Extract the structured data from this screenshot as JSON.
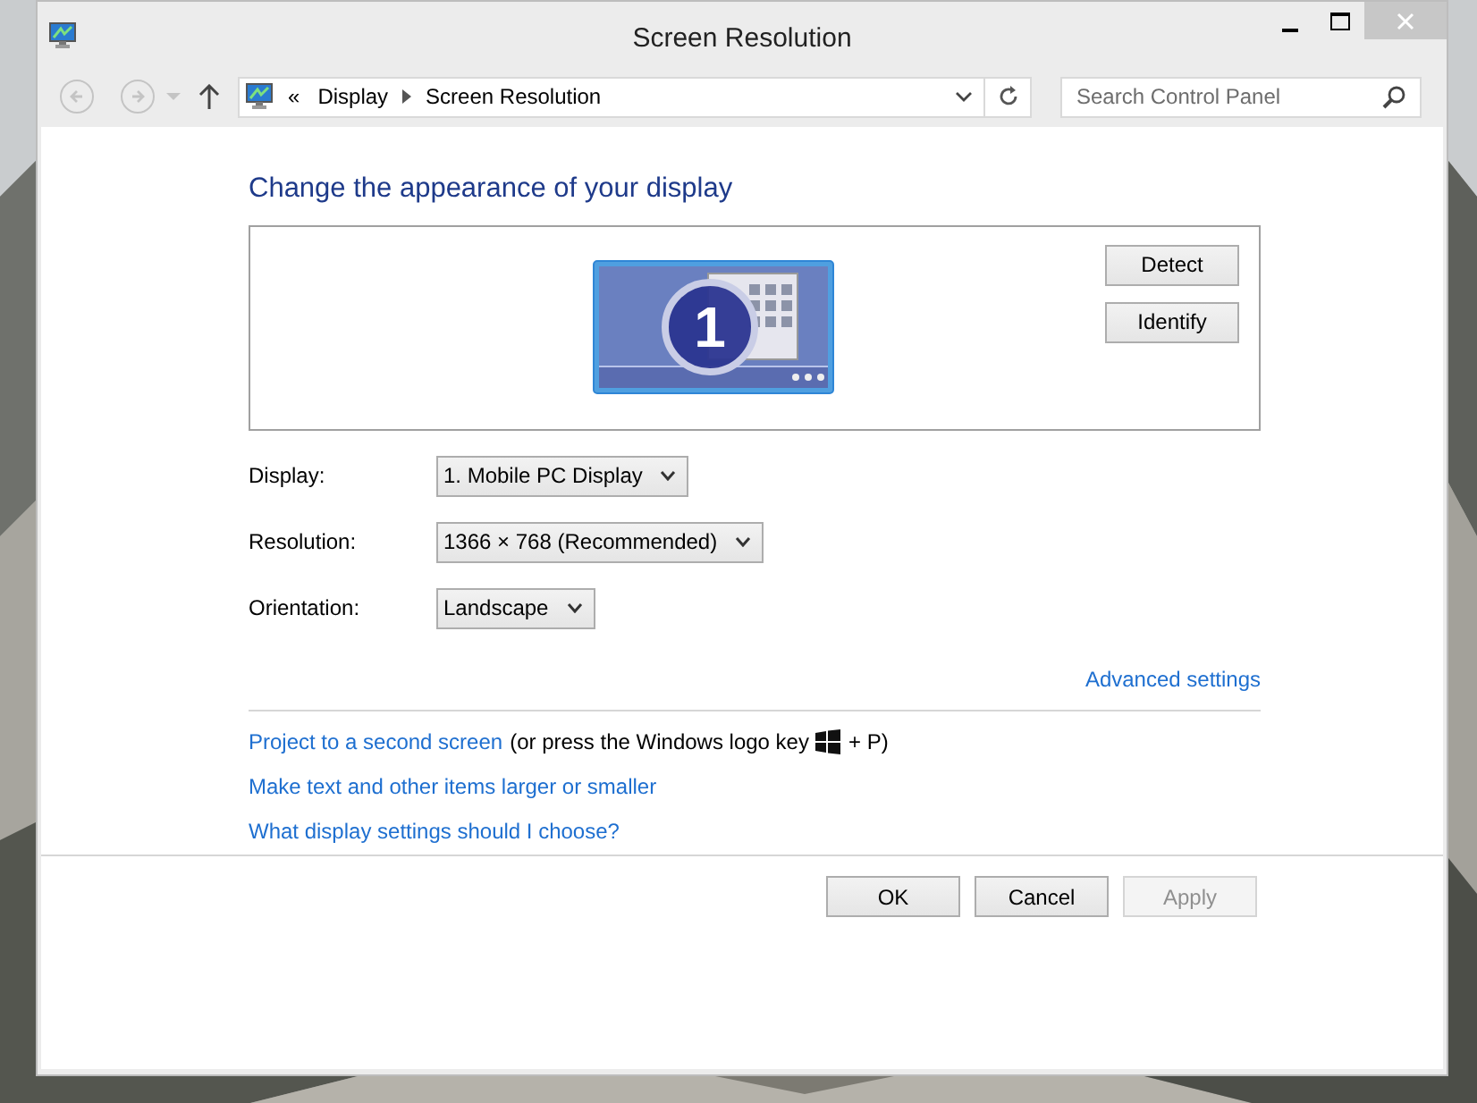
{
  "window": {
    "title": "Screen Resolution"
  },
  "address_bar": {
    "overflow": "«",
    "crumbs": [
      "Display",
      "Screen Resolution"
    ]
  },
  "search": {
    "placeholder": "Search Control Panel"
  },
  "heading": "Change the appearance of your display",
  "monitor_preview": {
    "number": "1"
  },
  "side_buttons": [
    {
      "label": "Detect"
    },
    {
      "label": "Identify"
    }
  ],
  "settings": [
    {
      "label": "Display:",
      "value": "1. Mobile PC Display"
    },
    {
      "label": "Resolution:",
      "value": "1366 × 768 (Recommended)"
    },
    {
      "label": "Orientation:",
      "value": "Landscape"
    }
  ],
  "advanced_link": "Advanced settings",
  "links": [
    {
      "text": "Project to a second screen",
      "note_before": "(or press the Windows logo key",
      "note_after": "+ P)"
    },
    {
      "text": "Make text and other items larger or smaller"
    },
    {
      "text": "What display settings should I choose?"
    }
  ],
  "buttons": [
    {
      "label": "OK",
      "disabled": false
    },
    {
      "label": "Cancel",
      "disabled": false
    },
    {
      "label": "Apply",
      "disabled": true
    }
  ]
}
